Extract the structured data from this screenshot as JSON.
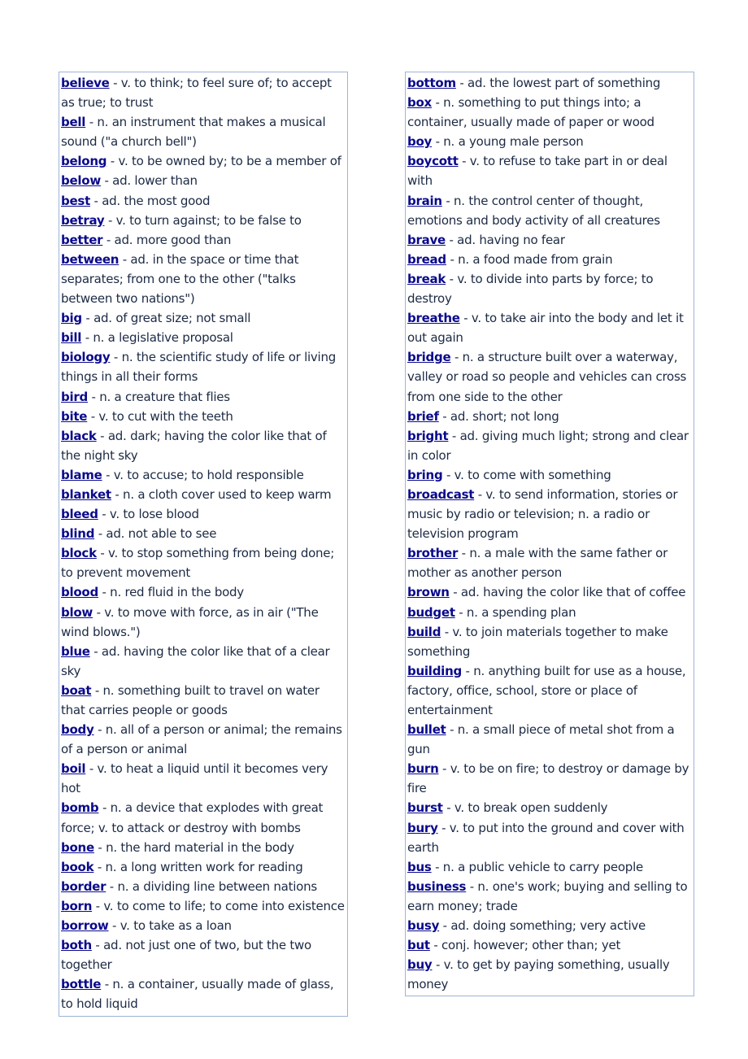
{
  "colors": {
    "link": "#0a0a8c",
    "text": "#1c2a44",
    "border": "#9db4d6"
  },
  "columns": [
    {
      "entries": [
        {
          "word": "believe",
          "def": " - v. to think; to feel sure of; to accept as true; to trust"
        },
        {
          "word": "bell",
          "def": " - n. an instrument that makes a musical sound (\"a church bell\")"
        },
        {
          "word": "belong",
          "def": " - v. to be owned by; to be a member of"
        },
        {
          "word": "below",
          "def": " - ad. lower than"
        },
        {
          "word": "best",
          "def": " - ad. the most good"
        },
        {
          "word": "betray",
          "def": " - v. to turn against; to be false to"
        },
        {
          "word": "better",
          "def": " - ad. more good than"
        },
        {
          "word": "between",
          "def": " - ad. in the space or time that separates; from one to the other (\"talks between two nations\")"
        },
        {
          "word": "big",
          "def": " - ad. of great size; not small"
        },
        {
          "word": "bill",
          "def": " - n. a legislative proposal"
        },
        {
          "word": "biology",
          "def": " - n. the scientific study of life or living things in all their forms"
        },
        {
          "word": "bird",
          "def": " - n. a creature that flies"
        },
        {
          "word": "bite",
          "def": " - v. to cut with the teeth"
        },
        {
          "word": "black",
          "def": " - ad. dark; having the color like that of the night sky"
        },
        {
          "word": "blame",
          "def": " - v. to accuse; to hold responsible"
        },
        {
          "word": "blanket",
          "def": " - n. a cloth cover used to keep warm"
        },
        {
          "word": "bleed",
          "def": " - v. to lose blood"
        },
        {
          "word": "blind",
          "def": " - ad. not able to see"
        },
        {
          "word": "block",
          "def": " - v. to stop something from being done; to prevent movement"
        },
        {
          "word": "blood",
          "def": " - n. red fluid in the body"
        },
        {
          "word": "blow",
          "def": " - v. to move with force, as in air (\"The wind blows.\")"
        },
        {
          "word": "blue",
          "def": " - ad. having the color like that of a clear sky"
        },
        {
          "word": "boat",
          "def": " - n. something built to travel on water that carries people or goods"
        },
        {
          "word": "body",
          "def": " - n. all of a person or animal; the remains of a person or animal"
        },
        {
          "word": "boil",
          "def": " - v. to heat a liquid until it becomes very hot"
        },
        {
          "word": "bomb",
          "def": " - n. a device that explodes with great force; v. to attack or destroy with bombs"
        },
        {
          "word": "bone",
          "def": " - n. the hard material in the body"
        },
        {
          "word": "book",
          "def": " - n. a long written work for reading"
        },
        {
          "word": "border",
          "def": " - n. a dividing line between nations"
        },
        {
          "word": "born",
          "def": " - v. to come to life; to come into existence"
        },
        {
          "word": "borrow",
          "def": " - v. to take as a loan"
        },
        {
          "word": "both",
          "def": " - ad. not just one of two, but the two together"
        },
        {
          "word": "bottle",
          "def": " - n. a container, usually made of glass, to hold liquid"
        }
      ]
    },
    {
      "entries": [
        {
          "word": "bottom",
          "def": " - ad. the lowest part of something"
        },
        {
          "word": "box",
          "def": " - n. something to put things into; a container, usually made of paper or wood"
        },
        {
          "word": "boy",
          "def": " - n. a young male person"
        },
        {
          "word": "boycott",
          "def": " - v. to refuse to take part in or deal with"
        },
        {
          "word": "brain",
          "def": " - n. the control center of thought, emotions and body activity of all creatures"
        },
        {
          "word": "brave",
          "def": " - ad. having no fear"
        },
        {
          "word": "bread",
          "def": " - n. a food made from grain"
        },
        {
          "word": "break",
          "def": " - v. to divide into parts by force; to destroy"
        },
        {
          "word": "breathe",
          "def": " - v. to take air into the body and let it out again"
        },
        {
          "word": "bridge",
          "def": " - n. a structure built over a waterway, valley or road so people and vehicles can cross from one side to the other"
        },
        {
          "word": "brief",
          "def": " - ad. short; not long"
        },
        {
          "word": "bright",
          "def": " - ad. giving much light; strong and clear in color"
        },
        {
          "word": "bring",
          "def": " - v. to come with something"
        },
        {
          "word": "broadcast",
          "def": " - v. to send information, stories or music by radio or television; n. a radio or television program"
        },
        {
          "word": "brother",
          "def": " - n. a male with the same father or mother as another person"
        },
        {
          "word": "brown",
          "def": " - ad. having the color like that of coffee"
        },
        {
          "word": "budget",
          "def": " - n. a spending plan"
        },
        {
          "word": "build",
          "def": " - v. to join materials together to make something"
        },
        {
          "word": "building",
          "def": " - n. anything built for use as a house, factory, office, school, store or place of entertainment"
        },
        {
          "word": "bullet",
          "def": " - n. a small piece of metal shot from a gun"
        },
        {
          "word": "burn",
          "def": " - v. to be on fire; to destroy or damage by fire"
        },
        {
          "word": "burst",
          "def": " - v. to break open suddenly"
        },
        {
          "word": "bury",
          "def": " - v. to put into the ground and cover with earth"
        },
        {
          "word": "bus",
          "def": " - n. a public vehicle to carry people"
        },
        {
          "word": "business",
          "def": " - n. one's work; buying and selling to earn money; trade"
        },
        {
          "word": "busy",
          "def": " - ad. doing something; very active"
        },
        {
          "word": "but",
          "def": " - conj. however; other than; yet"
        },
        {
          "word": "buy",
          "def": " - v. to get by paying something, usually money"
        }
      ]
    }
  ]
}
